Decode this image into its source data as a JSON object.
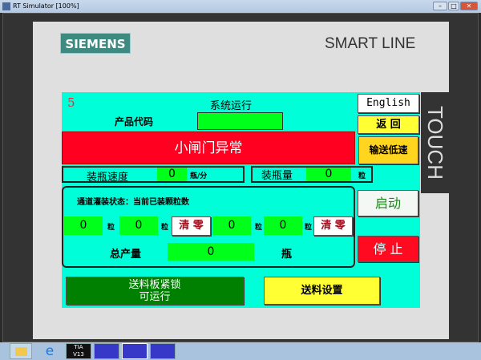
{
  "window": {
    "title": "RT Simulator [100%]",
    "min": "–",
    "max": "□",
    "close": "✕"
  },
  "device": {
    "brand": "SIEMENS",
    "model": "SMART LINE",
    "touch": "TOUCH"
  },
  "screen": {
    "screen_number": "5",
    "system_status": "系统运行",
    "product_code_label": "产品代码",
    "product_code_value": "",
    "alarm": "小闸门异常",
    "english_button": "English",
    "back_button": "返 回",
    "conveyor_low_speed_button": "输送低速",
    "speed_label": "装瓶速度",
    "speed_value": "0",
    "speed_unit": "瓶/分",
    "bottle_qty_label": "装瓶量",
    "bottle_qty_value": "0",
    "bottle_qty_unit": "粒",
    "channel_heading": "通道灌装状态：当前已装颗粒数",
    "channels": [
      {
        "value": "0",
        "unit": "粒"
      },
      {
        "value": "0",
        "unit": "粒"
      },
      {
        "value": "0",
        "unit": "粒"
      },
      {
        "value": "0",
        "unit": "粒"
      }
    ],
    "clear_button": "清 零",
    "total_label": "总产量",
    "total_value": "0",
    "total_unit": "瓶",
    "start_button": "启动",
    "stop_button": "停 止",
    "feed_lock_line1": "送料板紧锁",
    "feed_lock_line2": "可运行",
    "feed_settings_button": "送料设置"
  },
  "taskbar": {
    "items": [
      "explorer",
      "internet-explorer",
      "TIA V13",
      "WinCC flexible ES",
      "WinCC flexible RT",
      "WinCC flexible S"
    ]
  }
}
